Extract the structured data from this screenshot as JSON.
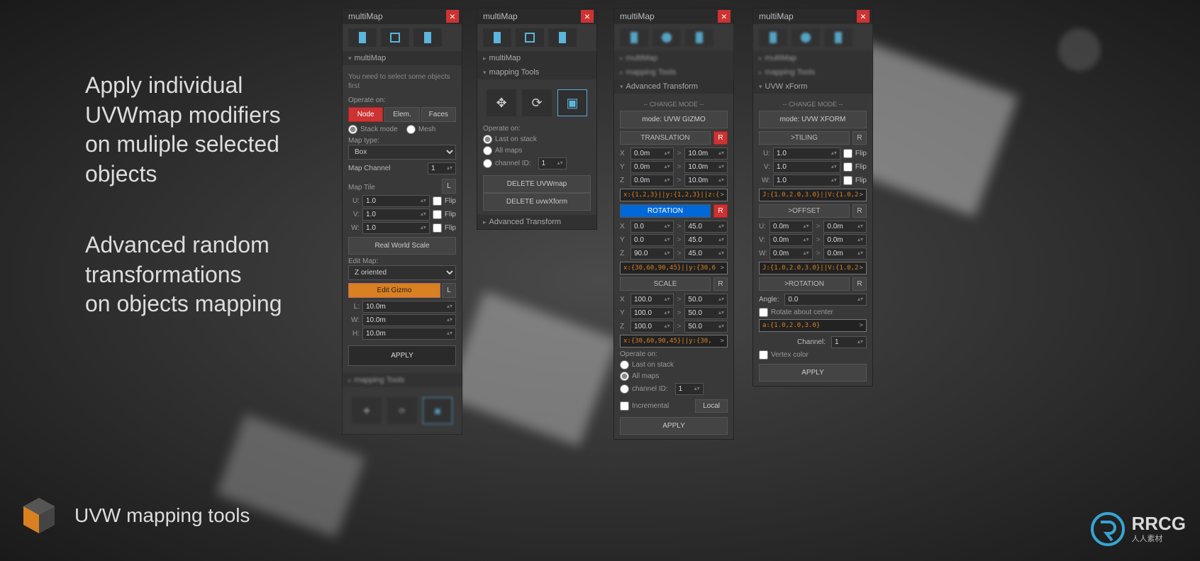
{
  "marketing": {
    "text1": "Apply individual\nUVWmap modifiers\non muliple selected\nobjects",
    "text2": "Advanced random\ntransformations\non objects mapping",
    "logo_text": "UVW mapping tools"
  },
  "watermark": {
    "name": "RRCG",
    "sub": "人人素材"
  },
  "panels": {
    "title": "multiMap",
    "p1": {
      "sections": {
        "multimap": "multiMap",
        "mapping_tools": "mapping Tools"
      },
      "hint": "You need to select some objects first",
      "operate_on_label": "Operate on:",
      "operate_buttons": [
        "Node",
        "Elem.",
        "Faces"
      ],
      "stack_mode": "Stack mode",
      "mesh": "Mesh",
      "map_type_label": "Map type:",
      "map_type_value": "Box",
      "map_channel_label": "Map Channel",
      "map_channel_value": "1",
      "map_tile_label": "Map Tile",
      "map_tile_L": "L",
      "uvw_labels": [
        "U:",
        "V:",
        "W:"
      ],
      "uvw_values": [
        "1.0",
        "1.0",
        "1.0"
      ],
      "flip_label": "Flip",
      "real_world_scale": "Real World Scale",
      "edit_map_label": "Edit Map:",
      "edit_map_value": "Z oriented",
      "edit_gizmo": "Edit Gizmo",
      "dim_labels": [
        "L:",
        "W:",
        "H:"
      ],
      "dim_values": [
        "10.0m",
        "10.0m",
        "10.0m"
      ],
      "apply": "APPLY"
    },
    "p2": {
      "operate_on_label": "Operate on:",
      "last_on_stack": "Last on stack",
      "all_maps": "All maps",
      "channel_id": "channel ID:",
      "channel_id_value": "1",
      "delete_uvwmap": "DELETE UVWmap",
      "delete_uvwxform": "DELETE uvwXform",
      "adv_transform": "Advanced Transform"
    },
    "p3": {
      "adv_transform": "Advanced Transform",
      "change_mode": "-- CHANGE MODE --",
      "mode_btn": "mode: UVW GIZMO",
      "translation": "TRANSLATION",
      "r_btn": "R",
      "trans_rows": [
        {
          "lbl": "X",
          "a": "0.0m",
          "b": "10.0m"
        },
        {
          "lbl": "Y",
          "a": "0.0m",
          "b": "10.0m"
        },
        {
          "lbl": "Z",
          "a": "0.0m",
          "b": "10.0m"
        }
      ],
      "trans_code": "x:{1,2,3}||y:{1,2,3}||z:{",
      "rotation": "ROTATION",
      "rot_rows": [
        {
          "lbl": "X",
          "a": "0.0",
          "b": "45.0"
        },
        {
          "lbl": "Y",
          "a": "0.0",
          "b": "45.0"
        },
        {
          "lbl": "Z",
          "a": "90.0",
          "b": "45.0"
        }
      ],
      "rot_code": "x:{30,60,90,45}||y:{30,6",
      "scale": "SCALE",
      "scale_rows": [
        {
          "lbl": "X",
          "a": "100.0",
          "b": "50.0"
        },
        {
          "lbl": "Y",
          "a": "100.0",
          "b": "50.0"
        },
        {
          "lbl": "Z",
          "a": "100.0",
          "b": "50.0"
        }
      ],
      "scale_code": "x:{30,60,90,45}||y:{30,",
      "operate_on_label": "Operate on:",
      "last_on_stack": "Last on stack",
      "all_maps": "All maps",
      "channel_id": "channel ID:",
      "channel_id_value": "1",
      "incremental": "Incremental",
      "local": "Local",
      "apply": "APPLY"
    },
    "p4": {
      "uvw_xform": "UVW xForm",
      "change_mode": "-- CHANGE MODE --",
      "mode_btn": "mode: UVW XFORM",
      "tiling": ">TILING",
      "r_btn": "R",
      "tiling_rows": [
        {
          "lbl": "U:",
          "a": "1.0"
        },
        {
          "lbl": "V:",
          "a": "1.0"
        },
        {
          "lbl": "W:",
          "a": "1.0"
        }
      ],
      "flip_label": "Flip",
      "tiling_code": "J:{1.0,2.0,3.0}||V:{1.0,2",
      "offset": ">OFFSET",
      "offset_rows": [
        {
          "lbl": "U:",
          "a": "0.0m",
          "b": "0.0m"
        },
        {
          "lbl": "V:",
          "a": "0.0m",
          "b": "0.0m"
        },
        {
          "lbl": "W:",
          "a": "0.0m",
          "b": "0.0m"
        }
      ],
      "offset_code": "J:{1.0,2.0,3.0}||V:{1.0,2",
      "rotation": ">ROTATION",
      "angle_label": "Angle:",
      "angle_value": "0.0",
      "rotate_center": "Rotate about center",
      "rot_code": "a:{1.0,2.0,3.0}",
      "channel_label": "Channel:",
      "channel_value": "1",
      "vertex_color": "Vertex color",
      "apply": "APPLY"
    }
  }
}
